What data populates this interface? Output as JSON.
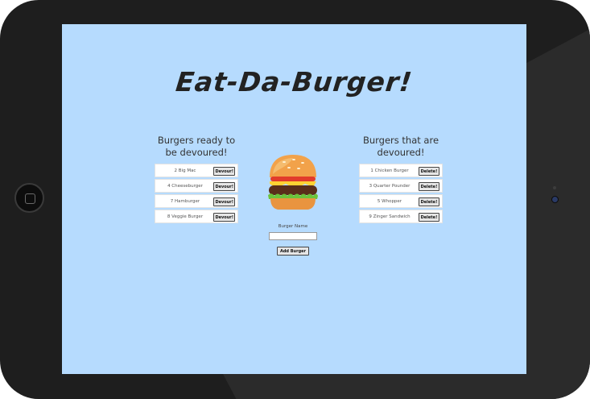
{
  "app": {
    "title": "Eat-Da-Burger!"
  },
  "ready": {
    "heading": "Burgers ready to be devoured!",
    "button_label": "Devour!",
    "items": [
      {
        "label": "2 Big Mac"
      },
      {
        "label": "4 Cheeseburger"
      },
      {
        "label": "7 Hamburger"
      },
      {
        "label": "8 Veggie Burger"
      }
    ]
  },
  "devoured": {
    "heading": "Burgers that are devoured!",
    "button_label": "Delete!",
    "items": [
      {
        "label": "1 Chicken Burger"
      },
      {
        "label": "3 Quarter Pounder"
      },
      {
        "label": "5 Whopper"
      },
      {
        "label": "9 Zinger Sandwich"
      }
    ]
  },
  "form": {
    "label": "Burger Name",
    "value": "",
    "button_label": "Add Burger"
  },
  "colors": {
    "screen_bg": "#b6dbfe",
    "tablet_bezel": "#1e1e1e"
  },
  "icons": {
    "burger": "hamburger-emoji"
  }
}
